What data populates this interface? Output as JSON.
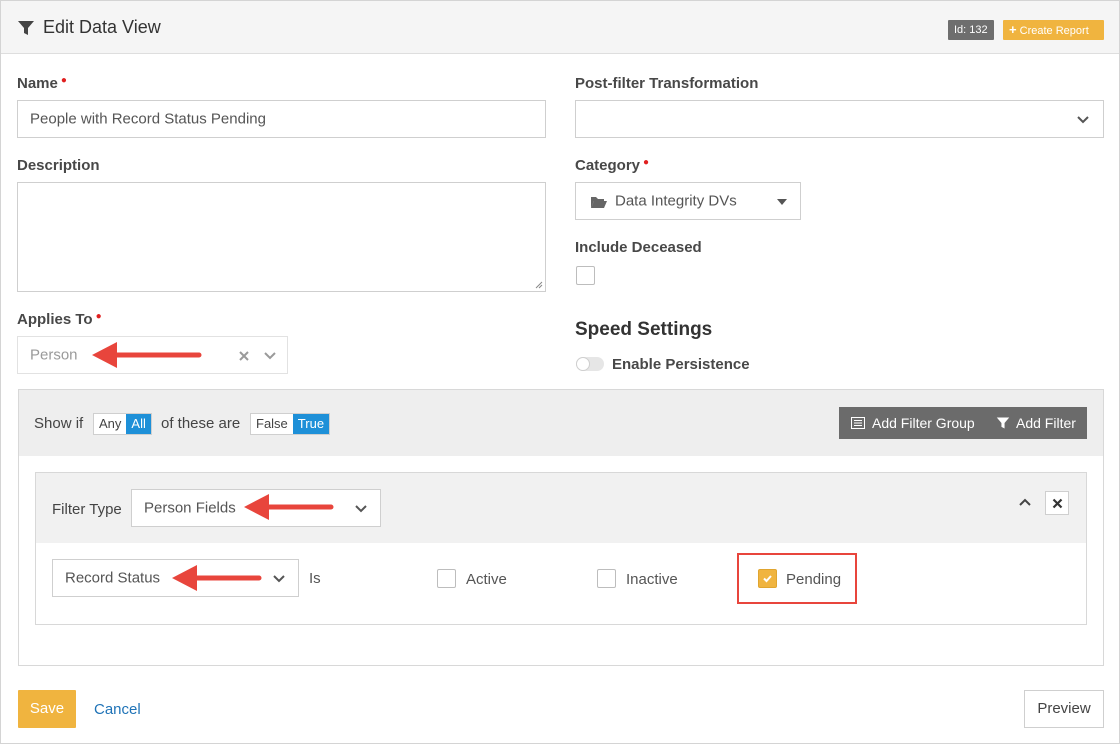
{
  "header": {
    "title": "Edit Data View",
    "id_badge": "Id: 132",
    "create_report": "Create Report"
  },
  "form": {
    "name_label": "Name",
    "name_value": "People with Record Status Pending",
    "description_label": "Description",
    "description_value": "",
    "applies_to_label": "Applies To",
    "applies_to_value": "Person",
    "post_filter_label": "Post-filter Transformation",
    "post_filter_value": "",
    "category_label": "Category",
    "category_value": "Data Integrity DVs",
    "include_deceased_label": "Include Deceased",
    "include_deceased_checked": false,
    "speed_settings_heading": "Speed Settings",
    "enable_persistence_label": "Enable Persistence",
    "enable_persistence_on": false
  },
  "filter": {
    "show_if": "Show if",
    "any": "Any",
    "all": "All",
    "of_these_are": "of these are",
    "false_label": "False",
    "true_label": "True",
    "add_filter_group": "Add Filter Group",
    "add_filter": "Add Filter",
    "filter_type_label": "Filter Type",
    "filter_type_value": "Person Fields",
    "field_value": "Record Status",
    "operator": "Is",
    "options": [
      {
        "label": "Active",
        "checked": false
      },
      {
        "label": "Inactive",
        "checked": false
      },
      {
        "label": "Pending",
        "checked": true
      }
    ]
  },
  "footer": {
    "save": "Save",
    "cancel": "Cancel",
    "preview": "Preview"
  },
  "colors": {
    "accent": "#f0b43f",
    "toggle_active": "#1e90d8",
    "annotation": "#e8453c"
  }
}
